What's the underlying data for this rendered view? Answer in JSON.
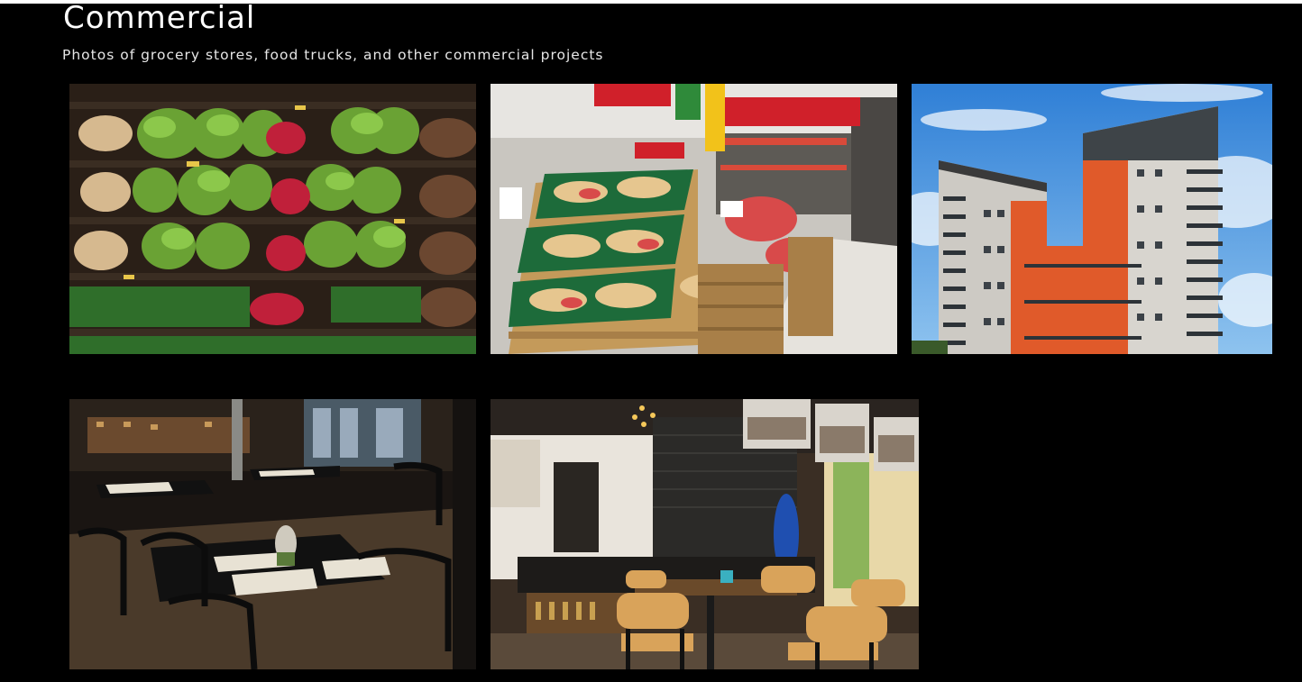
{
  "page": {
    "title": "Commercial",
    "subtitle": "Photos of grocery stores, food trucks, and other commercial projects"
  },
  "photos": [
    {
      "id": "produce-shelves"
    },
    {
      "id": "fruit-crates"
    },
    {
      "id": "apartment-tower"
    },
    {
      "id": "dark-restaurant"
    },
    {
      "id": "bright-cafe"
    }
  ],
  "colors": {
    "background": "#000000",
    "text": "#ffffff"
  }
}
